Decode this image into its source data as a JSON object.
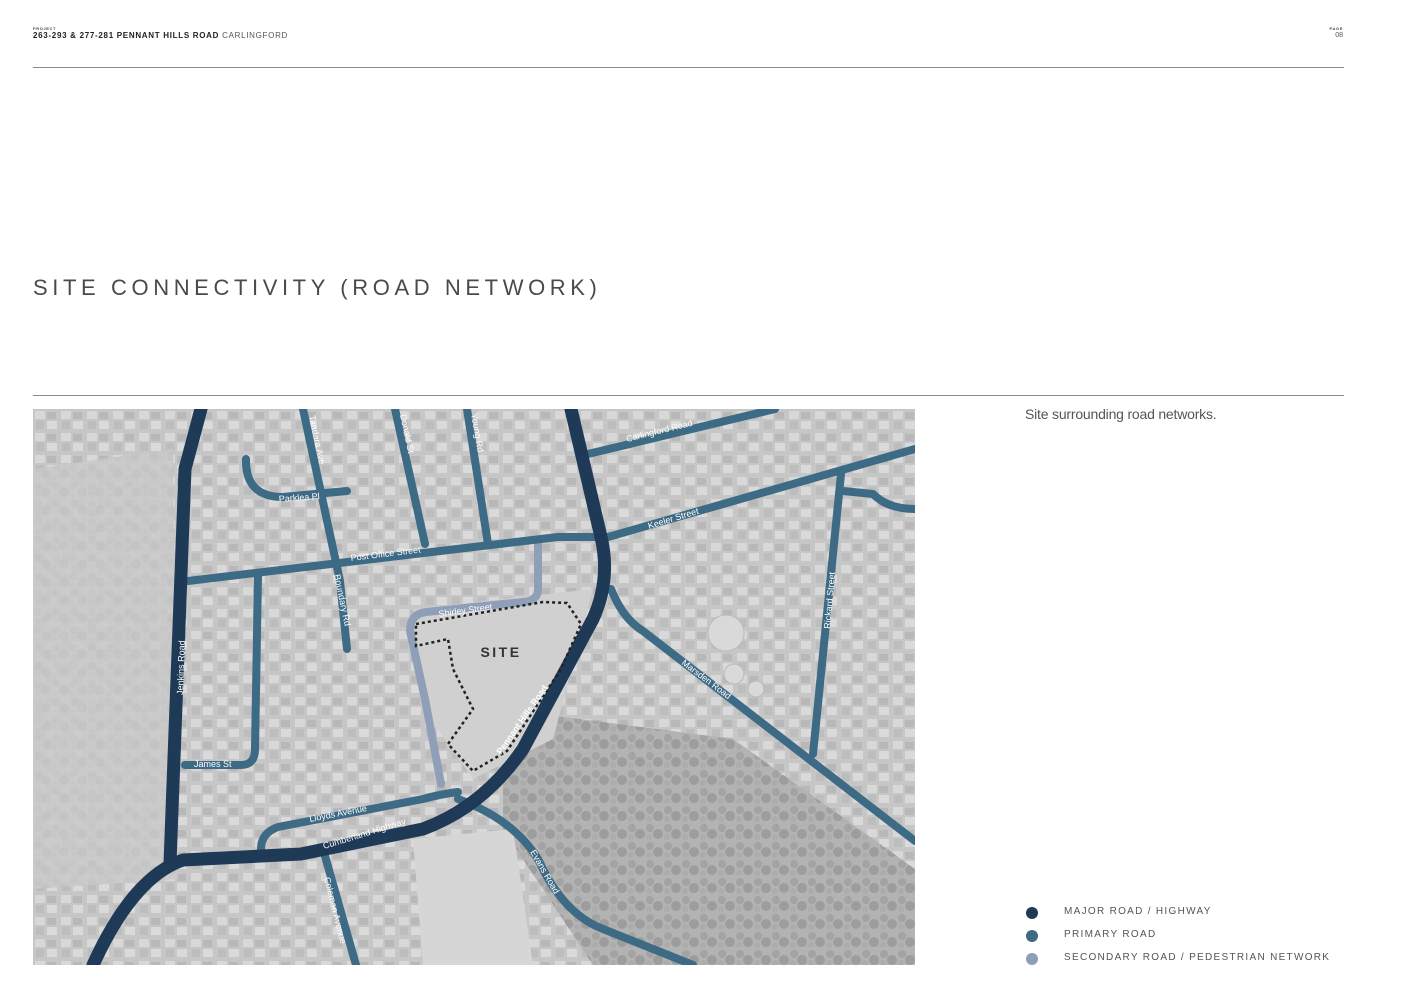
{
  "header": {
    "project_label": "PROJECT",
    "address": "263-293 & 277-281 PENNANT HILLS ROAD",
    "suburb": "CARLINGFORD",
    "page_label": "PAGE",
    "page_number": "08"
  },
  "title": "SITE CONNECTIVITY (ROAD NETWORK)",
  "caption": "Site surrounding road networks.",
  "map": {
    "site_label": "SITE",
    "road_labels": {
      "carlingford": "Carlingford Road",
      "keeler": "Keeler Street",
      "rickard": "Rickard Street",
      "marsden": "Marsden Road",
      "pennant_hills": "Pennant Hills Road",
      "cumberland": "Cumberland Highway",
      "lloyds": "Lloyds Avenue",
      "coleman": "Coleman Avenue",
      "evans": "Evans Road",
      "james": "James St",
      "jenkins": "Jenkins Road",
      "post_office": "Post Office Street",
      "shirley": "Shirley Street",
      "boundary": "Boundary Rd",
      "tandara": "Tandara Ave",
      "parklea": "Parklea Pl",
      "donald": "Donald St",
      "young": "Young Rd"
    },
    "colors": {
      "major": "#1f3a57",
      "primary": "#3d6a84",
      "secondary": "#8e9fb7",
      "base": "#c9c9c9",
      "site_outline": "#222222"
    }
  },
  "legend": [
    {
      "label": "MAJOR ROAD / HIGHWAY",
      "color": "#1f3a57"
    },
    {
      "label": "PRIMARY ROAD",
      "color": "#3d6a84"
    },
    {
      "label": "SECONDARY ROAD / PEDESTRIAN NETWORK",
      "color": "#8e9fb7"
    }
  ]
}
